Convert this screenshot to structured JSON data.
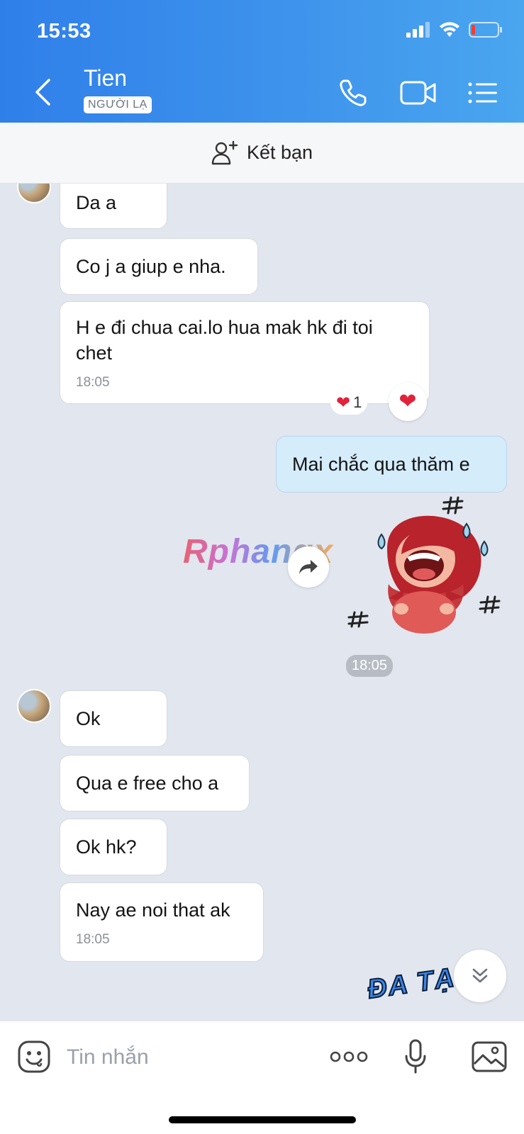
{
  "status_bar": {
    "time": "15:53"
  },
  "header": {
    "contact_name": "Tien",
    "badge": "NGƯỜI LẠ",
    "icons": [
      "back-icon",
      "phone-icon",
      "video-call-icon",
      "menu-list-icon"
    ]
  },
  "add_friend": {
    "label": "Kết bạn"
  },
  "messages": {
    "m1": {
      "text": "Da a"
    },
    "m2": {
      "text": "Co j a giup e nha."
    },
    "m3": {
      "line1": "H e đi chua cai.lo hua mak hk đi toi",
      "line2": "chet",
      "time": "18:05",
      "reaction_count": "1"
    },
    "m4": {
      "text": "Mai chắc qua thăm e"
    },
    "sticker_time": "18:05",
    "m5": {
      "text": "Ok"
    },
    "m6": {
      "text": "Qua e free cho a"
    },
    "m7": {
      "text": "Ok hk?"
    },
    "m8": {
      "text": "Nay ae noi that ak",
      "time": "18:05"
    }
  },
  "sticker_partial_text": "ĐA TẠ",
  "watermark": "Rphangx",
  "input": {
    "placeholder": "Tin nhắn"
  },
  "colors": {
    "header_start": "#2f7fe9",
    "header_end": "#4aa6ef",
    "chat_bg": "#e2e6ee",
    "outgoing_bubble": "#d5ecfb",
    "heart": "#e0233a"
  }
}
